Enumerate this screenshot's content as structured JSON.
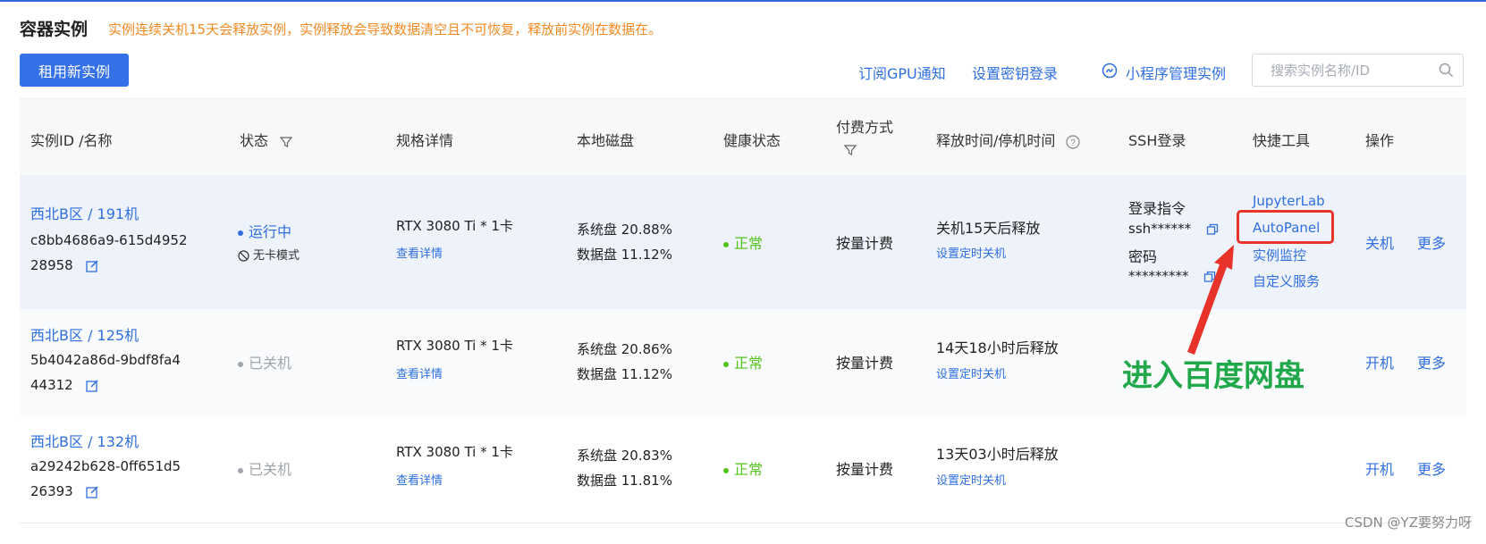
{
  "page": {
    "title": "容器实例",
    "notice": "实例连续关机15天会释放实例，实例释放会导致数据清空且不可恢复，释放前实例在数据在。"
  },
  "toolbar": {
    "rent_button": "租用新实例",
    "subscribe_gpu": "订阅GPU通知",
    "set_key_login": "设置密钥登录",
    "miniprogram_manage": "小程序管理实例",
    "search_placeholder": "搜索实例名称/ID"
  },
  "table": {
    "headers": {
      "id_name": "实例ID /名称",
      "status": "状态",
      "spec": "规格详情",
      "disk": "本地磁盘",
      "health": "健康状态",
      "payment": "付费方式",
      "release_time": "释放时间/停机时间",
      "ssh": "SSH登录",
      "tools": "快捷工具",
      "actions": "操作"
    },
    "rows": [
      {
        "region_name": "西北B区 / 191机",
        "id_line1": "c8bb4686a9-615d4952",
        "id_line2": "28958",
        "status": "运行中",
        "status_color": "#2f6fe0",
        "mode": "无卡模式",
        "spec": "RTX 3080 Ti * 1卡",
        "spec_detail": "查看详情",
        "system_disk": "系统盘 20.88%",
        "data_disk": "数据盘 11.12%",
        "health": "正常",
        "payment": "按量计费",
        "release": "关机15天后释放",
        "schedule_shutdown": "设置定时关机",
        "ssh_cmd_label": "登录指令",
        "ssh_cmd_value": "ssh******",
        "ssh_pwd_label": "密码",
        "ssh_pwd_value": "*********",
        "tools": [
          "JupyterLab",
          "AutoPanel",
          "实例监控",
          "自定义服务"
        ],
        "action_primary": "关机",
        "action_more": "更多"
      },
      {
        "region_name": "西北B区 / 125机",
        "id_line1": "5b4042a86d-9bdf8fa4",
        "id_line2": "44312",
        "status": "已关机",
        "status_color": "#a0a4ab",
        "spec": "RTX 3080 Ti * 1卡",
        "spec_detail": "查看详情",
        "system_disk": "系统盘 20.86%",
        "data_disk": "数据盘 11.12%",
        "health": "正常",
        "payment": "按量计费",
        "release": "14天18小时后释放",
        "schedule_shutdown": "设置定时关机",
        "action_primary": "开机",
        "action_more": "更多"
      },
      {
        "region_name": "西北B区 / 132机",
        "id_line1": "a29242b628-0ff651d5",
        "id_line2": "26393",
        "status": "已关机",
        "status_color": "#a0a4ab",
        "spec": "RTX 3080 Ti * 1卡",
        "spec_detail": "查看详情",
        "system_disk": "系统盘 20.83%",
        "data_disk": "数据盘 11.81%",
        "health": "正常",
        "payment": "按量计费",
        "release": "13天03小时后释放",
        "schedule_shutdown": "设置定时关机",
        "action_primary": "开机",
        "action_more": "更多"
      }
    ]
  },
  "annotation": {
    "text": "进入百度网盘",
    "color": "#21a84a",
    "highlight_color": "#e8332b"
  },
  "watermark": "CSDN @YZ要努力呀",
  "colors": {
    "accent": "#3470e8",
    "link": "#2f6fe0",
    "warning": "#f08a24",
    "healthy": "#52c41a"
  }
}
